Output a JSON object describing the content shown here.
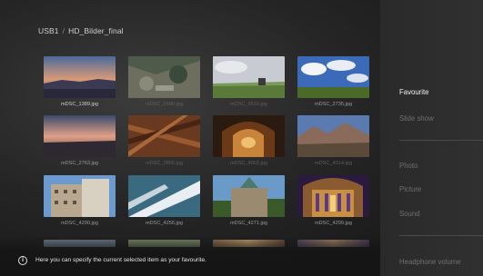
{
  "breadcrumb": {
    "source": "USB1",
    "separator": "/",
    "folder": "HD_Bilder_final"
  },
  "photos": [
    {
      "name": "mDSC_1389.jpg",
      "state": "selected"
    },
    {
      "name": "mDSC_2488.jpg",
      "state": "dim"
    },
    {
      "name": "mDSC_2516.jpg",
      "state": "dim"
    },
    {
      "name": "mDSC_2735.jpg",
      "state": "normal"
    },
    {
      "name": "mDSC_2763.jpg",
      "state": "normal"
    },
    {
      "name": "mDSC_2866.jpg",
      "state": "dim"
    },
    {
      "name": "mDSC_4002.jpg",
      "state": "dim"
    },
    {
      "name": "mDSC_4014.jpg",
      "state": "dim"
    },
    {
      "name": "mDSC_4290.jpg",
      "state": "normal"
    },
    {
      "name": "mDSC_4256.jpg",
      "state": "normal"
    },
    {
      "name": "mDSC_4271.jpg",
      "state": "normal"
    },
    {
      "name": "mDSC_4299.jpg",
      "state": "normal"
    },
    {
      "name": "",
      "state": "partial"
    },
    {
      "name": "",
      "state": "partial"
    },
    {
      "name": "",
      "state": "partial"
    },
    {
      "name": "",
      "state": "partial"
    }
  ],
  "side_menu": {
    "items": [
      {
        "label": "Favourite",
        "state": "active"
      },
      {
        "label": "Slide show",
        "state": "disabled"
      },
      {
        "label": "Photo",
        "state": "disabled"
      },
      {
        "label": "Picture",
        "state": "disabled"
      },
      {
        "label": "Sound",
        "state": "disabled"
      },
      {
        "label": "Headphone volume",
        "state": "disabled"
      }
    ]
  },
  "info_bar": {
    "icon": "info-icon",
    "text": "Here you can specify the current selected item as your favourite."
  },
  "colors": {
    "background": "#252525",
    "panel": "#2d2d2d",
    "active_text": "#f2f2f2",
    "disabled_text": "#6f6f6f"
  }
}
